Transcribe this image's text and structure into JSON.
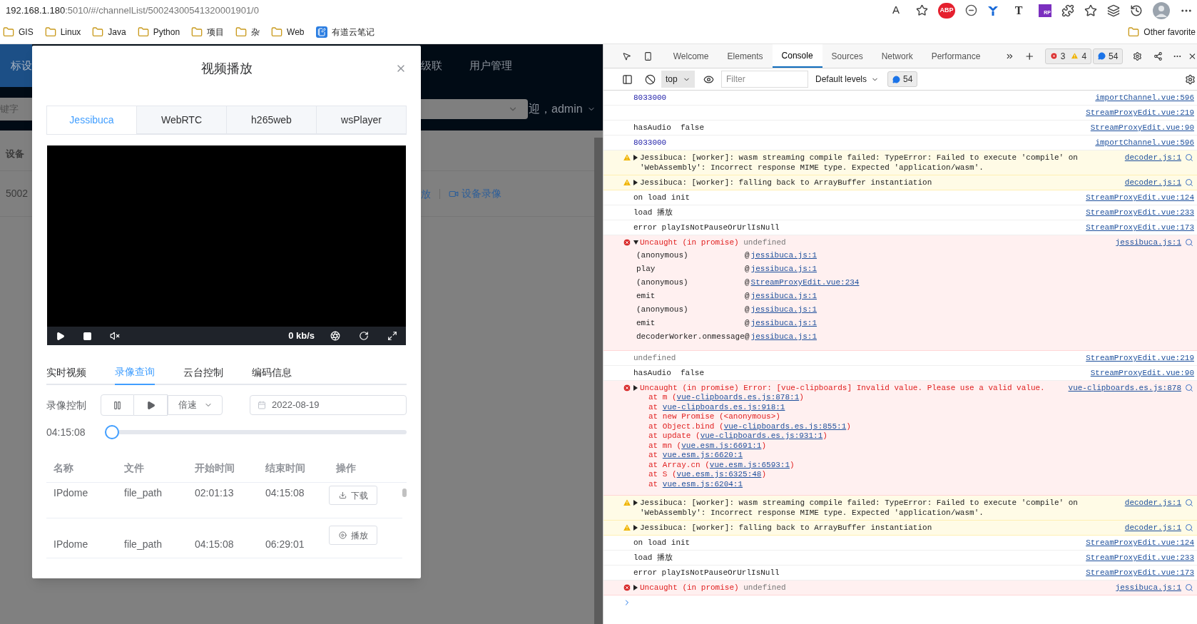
{
  "browser": {
    "url_host": "192.168.1.180",
    "url_path": ":5010/#/channelList/50024300541320001901/0",
    "extensions": [
      {
        "kind": "read-aloud",
        "label": "A"
      },
      {
        "kind": "add-favorite"
      },
      {
        "kind": "stop-sign",
        "label": "ABP"
      },
      {
        "kind": "ring"
      },
      {
        "kind": "y-mark"
      },
      {
        "kind": "letter",
        "label": "T"
      },
      {
        "kind": "square-badge",
        "label": "RP"
      },
      {
        "kind": "puzzle"
      },
      {
        "kind": "favorites"
      },
      {
        "kind": "collections"
      },
      {
        "kind": "history"
      },
      {
        "kind": "avatar"
      },
      {
        "kind": "more"
      }
    ],
    "bookmarks": [
      {
        "kind": "folder",
        "label": "GIS"
      },
      {
        "kind": "folder",
        "label": "Linux"
      },
      {
        "kind": "folder",
        "label": "Java"
      },
      {
        "kind": "folder",
        "label": "Python"
      },
      {
        "kind": "folder",
        "label": "项目"
      },
      {
        "kind": "folder",
        "label": "杂"
      },
      {
        "kind": "folder",
        "label": "Web"
      },
      {
        "kind": "note",
        "label": "有道云笔记"
      }
    ],
    "other_bookmarks": "Other favorite"
  },
  "background": {
    "nav": [
      {
        "label": "标设",
        "selected": true
      },
      {
        "label": "级联",
        "selected": false
      },
      {
        "label": "用户管理",
        "selected": false
      }
    ],
    "search_placeholder": "键字",
    "user": "迎，admin",
    "table_header": "设备",
    "row_id": "5002",
    "row_actions": [
      "放",
      "设备录像"
    ]
  },
  "modal": {
    "title": "视频播放",
    "player_tabs": [
      {
        "label": "Jessibuca",
        "selected": true
      },
      {
        "label": "WebRTC",
        "selected": false
      },
      {
        "label": "h265web",
        "selected": false
      },
      {
        "label": "wsPlayer",
        "selected": false
      }
    ],
    "playing": false,
    "muted": true,
    "bitrate": "0 kb/s",
    "section_tabs": [
      {
        "label": "实时视频",
        "selected": false
      },
      {
        "label": "录像查询",
        "selected": true
      },
      {
        "label": "云台控制",
        "selected": false
      },
      {
        "label": "编码信息",
        "selected": false
      }
    ],
    "record_label": "录像控制",
    "speed": "倍速",
    "date": "2022-08-19",
    "time": "04:15:08",
    "progress": {
      "level": 0
    },
    "table": {
      "columns": [
        "名称",
        "文件",
        "开始时间",
        "结束时间",
        "操作"
      ],
      "rows": [
        {
          "cells": [
            "IPdome",
            "file_path",
            "02:01:13",
            "04:15:08"
          ],
          "actions": [
            {
              "kind": "download",
              "label": "下载"
            }
          ]
        },
        {
          "cells": [
            "IPdome",
            "file_path",
            "04:15:08",
            "06:29:01"
          ],
          "actions": [
            {
              "kind": "play",
              "label": "播放"
            }
          ]
        }
      ]
    }
  },
  "devtools": {
    "tabs": [
      {
        "label": "Welcome",
        "selected": false
      },
      {
        "label": "Elements",
        "selected": false
      },
      {
        "label": "Console",
        "selected": true
      },
      {
        "label": "Sources",
        "selected": false
      },
      {
        "label": "Network",
        "selected": false
      },
      {
        "label": "Performance",
        "selected": false
      }
    ],
    "errors": "3",
    "warnings": "4",
    "messages": "54",
    "context": "top",
    "filter_placeholder": "Filter",
    "levels": "Default levels",
    "message_count": "54",
    "console": [
      {
        "kind": "value",
        "text": "8033000",
        "source": "importChannel.vue:596"
      },
      {
        "kind": "log",
        "source": "StreamProxyEdit.vue:219"
      },
      {
        "kind": "log",
        "text": "hasAudio  false",
        "source": "StreamProxyEdit.vue:90"
      },
      {
        "kind": "value",
        "text": "8033000",
        "source": "importChannel.vue:596"
      },
      {
        "kind": "warning",
        "expanded": false,
        "text": "Jessibuca: [worker]: wasm streaming compile failed: TypeError: Failed to execute 'compile' on 'WebAssembly': Incorrect response MIME type. Expected 'application/wasm'.",
        "source": "decoder.js:1"
      },
      {
        "kind": "warning",
        "expanded": false,
        "text": "Jessibuca: [worker]: falling back to ArrayBuffer instantiation",
        "source": "decoder.js:1"
      },
      {
        "kind": "log",
        "text": "on load init",
        "source": "StreamProxyEdit.vue:124"
      },
      {
        "kind": "log",
        "text": "load 播放",
        "source": "StreamProxyEdit.vue:233"
      },
      {
        "kind": "log",
        "text": "error playIsNotPauseOrUrlIsNull",
        "source": "StreamProxyEdit.vue:173"
      },
      {
        "kind": "error",
        "expanded": true,
        "text": "Uncaught (in promise)",
        "detail": "undefined",
        "source": "jessibuca.js:1",
        "frames": [
          {
            "fn": "(anonymous)",
            "at": "@",
            "link": "jessibuca.js:1"
          },
          {
            "fn": "play",
            "at": "@",
            "link": "jessibuca.js:1"
          },
          {
            "fn": "(anonymous)",
            "at": "@",
            "link": "StreamProxyEdit.vue:234"
          },
          {
            "fn": "emit",
            "at": "@",
            "link": "jessibuca.js:1"
          },
          {
            "fn": "(anonymous)",
            "at": "@",
            "link": "jessibuca.js:1"
          },
          {
            "fn": "emit",
            "at": "@",
            "link": "jessibuca.js:1"
          },
          {
            "fn": "decoderWorker.onmessage",
            "at": "@",
            "link": "jessibuca.js:1"
          }
        ]
      },
      {
        "kind": "muted",
        "text": "undefined",
        "source": "StreamProxyEdit.vue:219"
      },
      {
        "kind": "log",
        "text": "hasAudio  false",
        "source": "StreamProxyEdit.vue:90"
      },
      {
        "kind": "error",
        "expanded": false,
        "text": "Uncaught (in promise) Error: [vue-clipboards] Invalid value. Please use a valid value.",
        "source": "vue-clipboards.es.js:878",
        "stack": [
          {
            "before": "at m (",
            "link": "vue-clipboards.es.js:878:1",
            "after": ")"
          },
          {
            "before": "at ",
            "link": "vue-clipboards.es.js:918:1"
          },
          {
            "before": "at new Promise (<anonymous>)"
          },
          {
            "before": "at Object.bind (",
            "link": "vue-clipboards.es.js:855:1",
            "after": ")"
          },
          {
            "before": "at update (",
            "link": "vue-clipboards.es.js:931:1",
            "after": ")"
          },
          {
            "before": "at mn (",
            "link": "vue.esm.js:6691:1",
            "after": ")"
          },
          {
            "before": "at ",
            "link": "vue.esm.js:6620:1"
          },
          {
            "before": "at Array.cn (",
            "link": "vue.esm.js:6593:1",
            "after": ")"
          },
          {
            "before": "at S (",
            "link": "vue.esm.js:6325:48",
            "after": ")"
          },
          {
            "before": "at ",
            "link": "vue.esm.js:6204:1"
          }
        ]
      },
      {
        "kind": "warning",
        "expanded": false,
        "text": "Jessibuca: [worker]: wasm streaming compile failed: TypeError: Failed to execute 'compile' on 'WebAssembly': Incorrect response MIME type. Expected 'application/wasm'.",
        "source": "decoder.js:1"
      },
      {
        "kind": "warning",
        "expanded": false,
        "text": "Jessibuca: [worker]: falling back to ArrayBuffer instantiation",
        "source": "decoder.js:1"
      },
      {
        "kind": "log",
        "text": "on load init",
        "source": "StreamProxyEdit.vue:124"
      },
      {
        "kind": "log",
        "text": "load 播放",
        "source": "StreamProxyEdit.vue:233"
      },
      {
        "kind": "log",
        "text": "error playIsNotPauseOrUrlIsNull",
        "source": "StreamProxyEdit.vue:173"
      },
      {
        "kind": "error",
        "expanded": false,
        "text": "Uncaught (in promise)",
        "detail": "undefined",
        "source": "jessibuca.js:1"
      }
    ]
  }
}
